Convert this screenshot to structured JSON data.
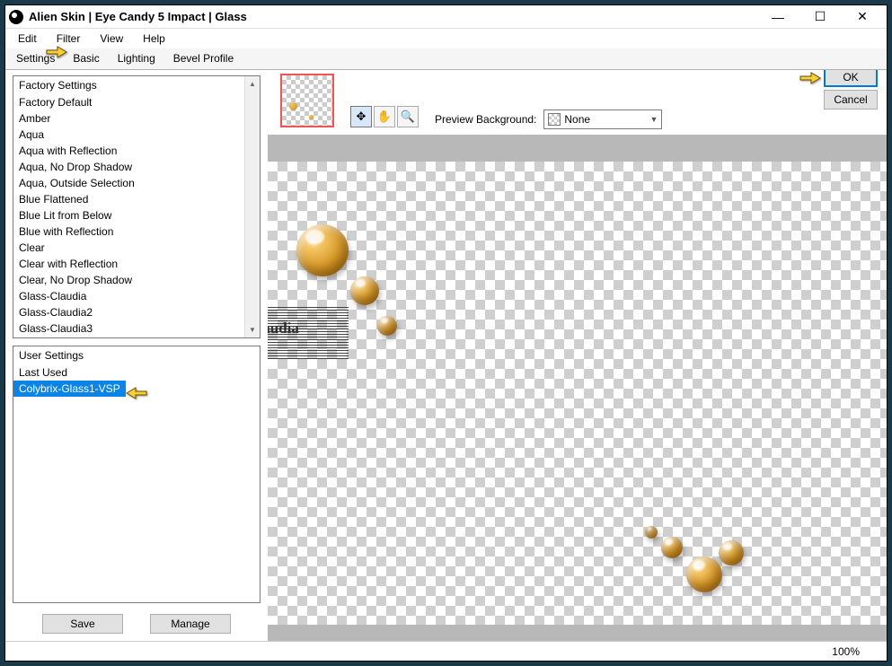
{
  "title": "Alien Skin | Eye Candy 5 Impact | Glass",
  "menu": {
    "edit": "Edit",
    "filter": "Filter",
    "view": "View",
    "help": "Help"
  },
  "tabs": {
    "settings": "Settings",
    "basic": "Basic",
    "lighting": "Lighting",
    "bevel": "Bevel Profile"
  },
  "factory": {
    "header": "Factory Settings",
    "items": [
      "Factory Default",
      "Amber",
      "Aqua",
      "Aqua with Reflection",
      "Aqua, No Drop Shadow",
      "Aqua, Outside Selection",
      "Blue Flattened",
      "Blue Lit from Below",
      "Blue with Reflection",
      "Clear",
      "Clear with Reflection",
      "Clear, No Drop Shadow",
      "Glass-Claudia",
      "Glass-Claudia2",
      "Glass-Claudia3"
    ]
  },
  "user": {
    "header": "User Settings",
    "items": [
      "Last Used",
      "Colybrix-Glass1-VSP"
    ],
    "selected": 1
  },
  "buttons": {
    "save": "Save",
    "manage": "Manage",
    "ok": "OK",
    "cancel": "Cancel"
  },
  "preview_bg": {
    "label": "Preview Background:",
    "value": "None"
  },
  "zoom": "100%",
  "watermark": "claudia",
  "win_controls": {
    "min": "—",
    "max": "☐",
    "close": "✕"
  },
  "icons": {
    "move": "✥",
    "hand": "✋",
    "zoom": "🔍"
  }
}
